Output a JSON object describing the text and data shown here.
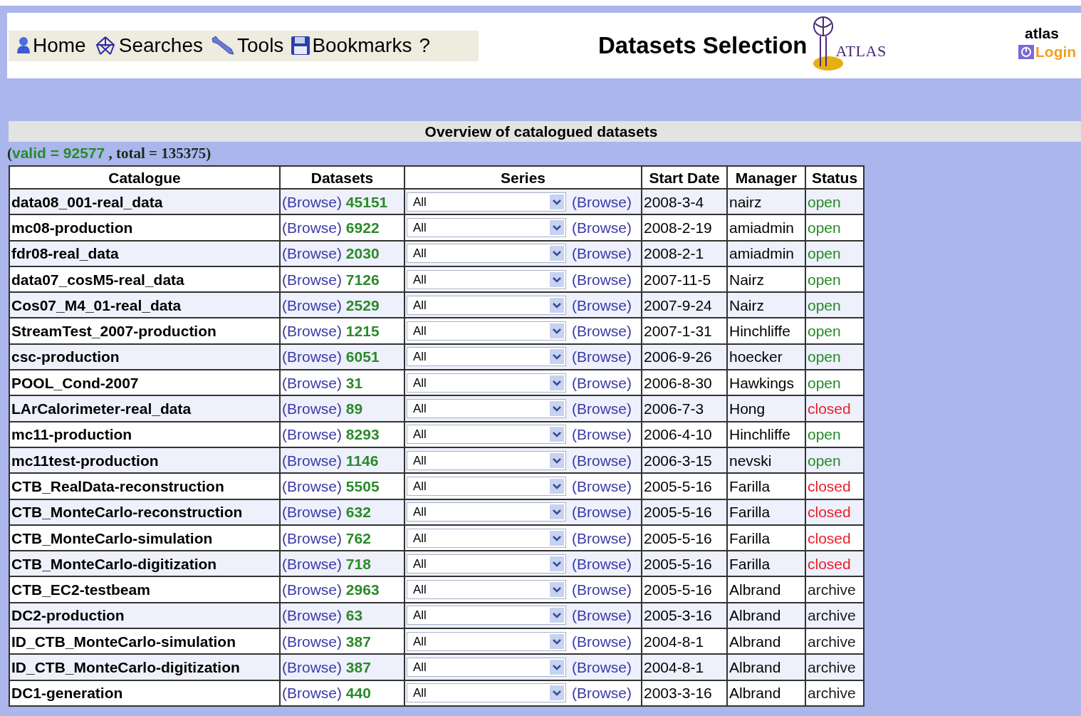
{
  "nav": [
    {
      "label": "Home",
      "kind": "person"
    },
    {
      "label": "Searches",
      "kind": "network"
    },
    {
      "label": "Tools",
      "kind": "wrench"
    },
    {
      "label": "Bookmarks",
      "kind": "disk"
    },
    {
      "label": "?",
      "kind": "help"
    }
  ],
  "title": "Datasets Selection",
  "logo_text": "ATLAS",
  "user": "atlas",
  "login": "Login",
  "overview": "Overview of catalogued datasets",
  "counts": {
    "valid": "valid = 92577",
    "total": ", total = 135375)",
    "open_paren": "("
  },
  "table": {
    "columns": [
      "Catalogue",
      "Datasets",
      "Series",
      "Start Date",
      "Manager",
      "Status"
    ],
    "rows": [
      {
        "catalogue": "data08_001-real_data",
        "browse": "(Browse)",
        "count": "45151",
        "series": "All",
        "series_browse": "(Browse)",
        "start": "2008-3-4",
        "manager": "nairz",
        "status": "open",
        "color": "#228b22"
      },
      {
        "catalogue": "mc08-production",
        "browse": "(Browse)",
        "count": "6922",
        "series": "All",
        "series_browse": "(Browse)",
        "start": "2008-2-19",
        "manager": "amiadmin",
        "status": "open",
        "color": "#228b22"
      },
      {
        "catalogue": "fdr08-real_data",
        "browse": "(Browse)",
        "count": "2030",
        "series": "All",
        "series_browse": "(Browse)",
        "start": "2008-2-1",
        "manager": "amiadmin",
        "status": "open",
        "color": "#228b22"
      },
      {
        "catalogue": "data07_cosM5-real_data",
        "browse": "(Browse)",
        "count": "7126",
        "series": "All",
        "series_browse": "(Browse)",
        "start": "2007-11-5",
        "manager": "Nairz",
        "status": "open",
        "color": "#228b22"
      },
      {
        "catalogue": "Cos07_M4_01-real_data",
        "browse": "(Browse)",
        "count": "2529",
        "series": "All",
        "series_browse": "(Browse)",
        "start": "2007-9-24",
        "manager": "Nairz",
        "status": "open",
        "color": "#228b22"
      },
      {
        "catalogue": "StreamTest_2007-production",
        "browse": "(Browse)",
        "count": "1215",
        "series": "All",
        "series_browse": "(Browse)",
        "start": "2007-1-31",
        "manager": "Hinchliffe",
        "status": "open",
        "color": "#228b22"
      },
      {
        "catalogue": "csc-production",
        "browse": "(Browse)",
        "count": "6051",
        "series": "All",
        "series_browse": "(Browse)",
        "start": "2006-9-26",
        "manager": "hoecker",
        "status": "open",
        "color": "#228b22"
      },
      {
        "catalogue": "POOL_Cond-2007",
        "browse": "(Browse)",
        "count": "31",
        "series": "All",
        "series_browse": "(Browse)",
        "start": "2006-8-30",
        "manager": "Hawkings",
        "status": "open",
        "color": "#228b22"
      },
      {
        "catalogue": "LArCalorimeter-real_data",
        "browse": "(Browse)",
        "count": "89",
        "series": "All",
        "series_browse": "(Browse)",
        "start": "2006-7-3",
        "manager": "Hong",
        "status": "closed",
        "color": "#e8202a"
      },
      {
        "catalogue": "mc11-production",
        "browse": "(Browse)",
        "count": "8293",
        "series": "All",
        "series_browse": "(Browse)",
        "start": "2006-4-10",
        "manager": "Hinchliffe",
        "status": "open",
        "color": "#228b22"
      },
      {
        "catalogue": "mc11test-production",
        "browse": "(Browse)",
        "count": "1146",
        "series": "All",
        "series_browse": "(Browse)",
        "start": "2006-3-15",
        "manager": "nevski",
        "status": "open",
        "color": "#228b22"
      },
      {
        "catalogue": "CTB_RealData-reconstruction",
        "browse": "(Browse)",
        "count": "5505",
        "series": "All",
        "series_browse": "(Browse)",
        "start": "2005-5-16",
        "manager": "Farilla",
        "status": "closed",
        "color": "#e8202a"
      },
      {
        "catalogue": "CTB_MonteCarlo-reconstruction",
        "browse": "(Browse)",
        "count": "632",
        "series": "All",
        "series_browse": "(Browse)",
        "start": "2005-5-16",
        "manager": "Farilla",
        "status": "closed",
        "color": "#e8202a"
      },
      {
        "catalogue": "CTB_MonteCarlo-simulation",
        "browse": "(Browse)",
        "count": "762",
        "series": "All",
        "series_browse": "(Browse)",
        "start": "2005-5-16",
        "manager": "Farilla",
        "status": "closed",
        "color": "#e8202a"
      },
      {
        "catalogue": "CTB_MonteCarlo-digitization",
        "browse": "(Browse)",
        "count": "718",
        "series": "All",
        "series_browse": "(Browse)",
        "start": "2005-5-16",
        "manager": "Farilla",
        "status": "closed",
        "color": "#e8202a"
      },
      {
        "catalogue": "CTB_EC2-testbeam",
        "browse": "(Browse)",
        "count": "2963",
        "series": "All",
        "series_browse": "(Browse)",
        "start": "2005-5-16",
        "manager": "Albrand",
        "status": "archive",
        "color": "#1a1a1a"
      },
      {
        "catalogue": "DC2-production",
        "browse": "(Browse)",
        "count": "63",
        "series": "All",
        "series_browse": "(Browse)",
        "start": "2005-3-16",
        "manager": "Albrand",
        "status": "archive",
        "color": "#1a1a1a"
      },
      {
        "catalogue": "ID_CTB_MonteCarlo-simulation",
        "browse": "(Browse)",
        "count": "387",
        "series": "All",
        "series_browse": "(Browse)",
        "start": "2004-8-1",
        "manager": "Albrand",
        "status": "archive",
        "color": "#1a1a1a"
      },
      {
        "catalogue": "ID_CTB_MonteCarlo-digitization",
        "browse": "(Browse)",
        "count": "387",
        "series": "All",
        "series_browse": "(Browse)",
        "start": "2004-8-1",
        "manager": "Albrand",
        "status": "archive",
        "color": "#1a1a1a"
      },
      {
        "catalogue": "DC1-generation",
        "browse": "(Browse)",
        "count": "440",
        "series": "All",
        "series_browse": "(Browse)",
        "start": "2003-3-16",
        "manager": "Albrand",
        "status": "archive",
        "color": "#1a1a1a"
      }
    ]
  }
}
